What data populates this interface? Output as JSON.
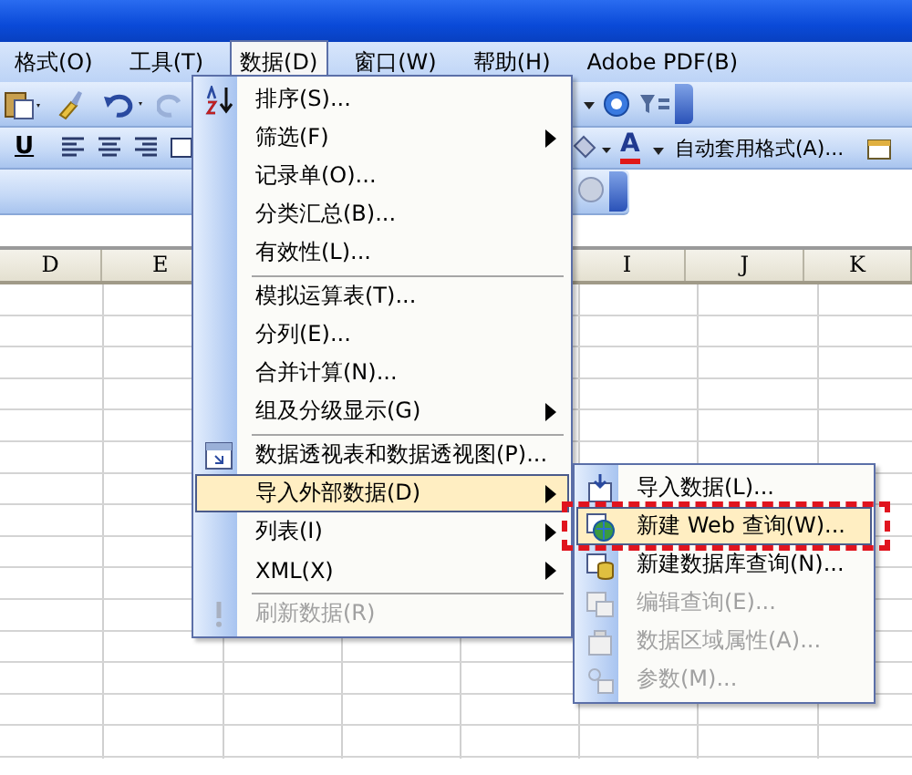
{
  "menubar": [
    {
      "label": "格式(O)",
      "selected": false
    },
    {
      "label": "工具(T)",
      "selected": false
    },
    {
      "label": "数据(D)",
      "selected": true
    },
    {
      "label": "窗口(W)",
      "selected": false
    },
    {
      "label": "帮助(H)",
      "selected": false
    },
    {
      "label": "Adobe PDF(B)",
      "selected": false
    }
  ],
  "formatting_toolbar": {
    "underline_label": "U",
    "font_color_label": "A",
    "autoformat_label": "自动套用格式(A)..."
  },
  "columns": [
    "D",
    "E",
    "I",
    "J",
    "K"
  ],
  "data_menu": {
    "items": [
      {
        "label": "排序(S)...",
        "submenu": false,
        "selected": false,
        "disabled": false,
        "separator_before": false
      },
      {
        "label": "筛选(F)",
        "submenu": true,
        "selected": false,
        "disabled": false,
        "separator_before": false
      },
      {
        "label": "记录单(O)...",
        "submenu": false,
        "selected": false,
        "disabled": false,
        "separator_before": false
      },
      {
        "label": "分类汇总(B)...",
        "submenu": false,
        "selected": false,
        "disabled": false,
        "separator_before": false
      },
      {
        "label": "有效性(L)...",
        "submenu": false,
        "selected": false,
        "disabled": false,
        "separator_before": false
      },
      {
        "label": "模拟运算表(T)...",
        "submenu": false,
        "selected": false,
        "disabled": false,
        "separator_before": true
      },
      {
        "label": "分列(E)...",
        "submenu": false,
        "selected": false,
        "disabled": false,
        "separator_before": false
      },
      {
        "label": "合并计算(N)...",
        "submenu": false,
        "selected": false,
        "disabled": false,
        "separator_before": false
      },
      {
        "label": "组及分级显示(G)",
        "submenu": true,
        "selected": false,
        "disabled": false,
        "separator_before": false
      },
      {
        "label": "数据透视表和数据透视图(P)...",
        "submenu": false,
        "selected": false,
        "disabled": false,
        "separator_before": true
      },
      {
        "label": "导入外部数据(D)",
        "submenu": true,
        "selected": true,
        "disabled": false,
        "separator_before": false
      },
      {
        "label": "列表(I)",
        "submenu": true,
        "selected": false,
        "disabled": false,
        "separator_before": false
      },
      {
        "label": "XML(X)",
        "submenu": true,
        "selected": false,
        "disabled": false,
        "separator_before": false
      },
      {
        "label": "刷新数据(R)",
        "submenu": false,
        "selected": false,
        "disabled": true,
        "separator_before": true
      }
    ]
  },
  "import_submenu": {
    "items": [
      {
        "label": "导入数据(L)...",
        "selected": false,
        "disabled": false,
        "framed": false
      },
      {
        "label": "新建 Web 查询(W)...",
        "selected": true,
        "disabled": false,
        "framed": true
      },
      {
        "label": "新建数据库查询(N)...",
        "selected": false,
        "disabled": false,
        "framed": false
      },
      {
        "label": "编辑查询(E)...",
        "selected": false,
        "disabled": true,
        "framed": false
      },
      {
        "label": "数据区域属性(A)...",
        "selected": false,
        "disabled": true,
        "framed": false
      },
      {
        "label": "参数(M)...",
        "selected": false,
        "disabled": true,
        "framed": false
      }
    ]
  }
}
